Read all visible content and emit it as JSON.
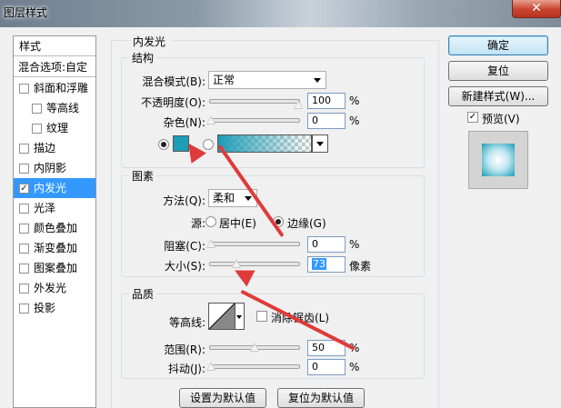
{
  "window": {
    "title": "图层样式",
    "close_glyph": "✕"
  },
  "left_panel": {
    "header": "样式",
    "blend_options": "混合选项:自定",
    "items": [
      {
        "label": "斜面和浮雕",
        "checked": false,
        "indent": false
      },
      {
        "label": "等高线",
        "checked": false,
        "indent": true
      },
      {
        "label": "纹理",
        "checked": false,
        "indent": true
      },
      {
        "label": "描边",
        "checked": false,
        "indent": false
      },
      {
        "label": "内阴影",
        "checked": false,
        "indent": false
      },
      {
        "label": "内发光",
        "checked": true,
        "indent": false,
        "selected": true
      },
      {
        "label": "光泽",
        "checked": false,
        "indent": false
      },
      {
        "label": "颜色叠加",
        "checked": false,
        "indent": false
      },
      {
        "label": "渐变叠加",
        "checked": false,
        "indent": false
      },
      {
        "label": "图案叠加",
        "checked": false,
        "indent": false
      },
      {
        "label": "外发光",
        "checked": false,
        "indent": false
      },
      {
        "label": "投影",
        "checked": false,
        "indent": false
      }
    ],
    "check_glyph": "✓"
  },
  "main": {
    "title": "内发光",
    "structure": {
      "legend": "结构",
      "blend_mode_label": "混合模式(B):",
      "blend_mode_value": "正常",
      "opacity_label": "不透明度(O):",
      "opacity_value": "100",
      "opacity_fraction": 1.0,
      "noise_label": "杂色(N):",
      "noise_value": "0",
      "noise_fraction": 0.0,
      "unit": "%",
      "color": "#1e9db6"
    },
    "elements": {
      "legend": "图素",
      "method_label": "方法(Q):",
      "method_value": "柔和",
      "source_label": "源:",
      "center_label": "居中(E)",
      "edge_label": "边缘(G)",
      "choke_label": "阻塞(C):",
      "choke_value": "0",
      "choke_fraction": 0.0,
      "size_label": "大小(S):",
      "size_value": "73",
      "size_fraction": 0.29,
      "size_unit": "像素",
      "unit": "%"
    },
    "quality": {
      "legend": "品质",
      "contour_label": "等高线:",
      "antialias_label": "消除锯齿(L)",
      "range_label": "范围(R):",
      "range_value": "50",
      "range_fraction": 0.5,
      "jitter_label": "抖动(J):",
      "jitter_value": "0",
      "jitter_fraction": 0.0,
      "unit": "%"
    },
    "set_default": "设置为默认值",
    "reset_default": "复位为默认值"
  },
  "right_panel": {
    "ok": "确定",
    "reset": "复位",
    "new_style": "新建样式(W)...",
    "preview_label": "预览(V)",
    "preview_checked": true
  },
  "colors": {
    "accent": "#1e9db6",
    "selection": "#3399ff",
    "annotation": "#e03a3a"
  }
}
